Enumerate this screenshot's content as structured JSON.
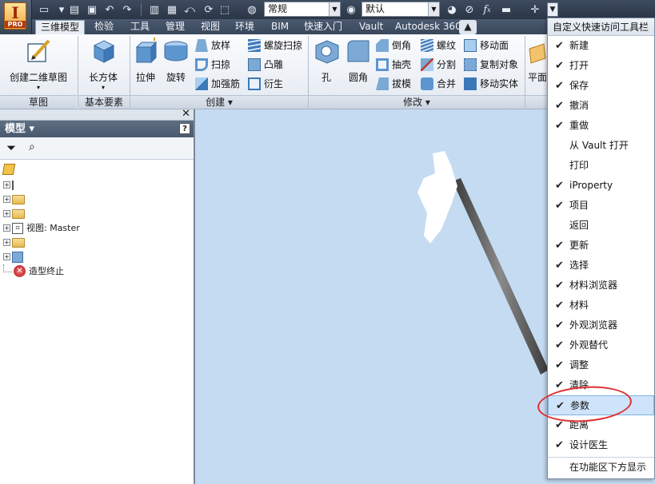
{
  "app": {
    "logo_letter": "I",
    "logo_badge": "PRO"
  },
  "qat": {
    "style_select": "常规",
    "appearance_select": "默认",
    "fx_label": "f",
    "fx_sub": "x"
  },
  "tabs": [
    "三维模型",
    "检验",
    "工具",
    "管理",
    "视图",
    "环境",
    "BIM",
    "快速入门",
    "Vault",
    "Autodesk 360"
  ],
  "ribbon": {
    "sketch": {
      "create_sketch": "创建二维草图",
      "panel": "草图"
    },
    "primitives": {
      "box": "长方体",
      "panel": "基本要素"
    },
    "create": {
      "extrude": "拉伸",
      "revolve": "旋转",
      "loft": "放样",
      "sweep": "扫掠",
      "rib": "加强筋",
      "coil": "螺旋扫掠",
      "emboss": "凸雕",
      "derive": "衍生",
      "panel": "创建 ▾"
    },
    "modify": {
      "hole": "孔",
      "fillet": "圆角",
      "chamfer": "倒角",
      "shell": "抽壳",
      "draft": "拔模",
      "thread": "螺纹",
      "split": "分割",
      "combine": "合并",
      "move_face": "移动面",
      "copy_object": "复制对象",
      "move_body": "移动实体",
      "panel": "修改 ▾"
    },
    "work": {
      "plane": "平面"
    }
  },
  "browser": {
    "title": "模型 ▾",
    "help": "?",
    "tree": [
      {
        "label": ""
      },
      {
        "label": ""
      },
      {
        "label": ""
      },
      {
        "label": ""
      },
      {
        "label": "视图: Master"
      },
      {
        "label": ""
      },
      {
        "label": ""
      },
      {
        "label": "造型终止"
      }
    ]
  },
  "menu": {
    "title": "自定义快速访问工具栏",
    "items": [
      {
        "label": "新建",
        "checked": true
      },
      {
        "label": "打开",
        "checked": true
      },
      {
        "label": "保存",
        "checked": true
      },
      {
        "label": "撤消",
        "checked": true
      },
      {
        "label": "重做",
        "checked": true
      },
      {
        "label": "从 Vault 打开",
        "checked": false
      },
      {
        "label": "打印",
        "checked": false
      },
      {
        "label": "iProperty",
        "checked": true
      },
      {
        "label": "项目",
        "checked": true
      },
      {
        "label": "返回",
        "checked": false
      },
      {
        "label": "更新",
        "checked": true
      },
      {
        "label": "选择",
        "checked": true
      },
      {
        "label": "材料浏览器",
        "checked": true
      },
      {
        "label": "材料",
        "checked": true
      },
      {
        "label": "外观浏览器",
        "checked": true
      },
      {
        "label": "外观替代",
        "checked": true
      },
      {
        "label": "调整",
        "checked": true
      },
      {
        "label": "清除",
        "checked": true
      },
      {
        "label": "参数",
        "checked": true
      },
      {
        "label": "距离",
        "checked": true
      },
      {
        "label": "设计医生",
        "checked": true
      },
      {
        "label": "在功能区下方显示",
        "checked": false
      }
    ],
    "check_glyph": "✔"
  },
  "colors": {
    "viewport": "#c4dbf2",
    "highlight": "#cfe4fa",
    "annotation": "#e03030"
  }
}
